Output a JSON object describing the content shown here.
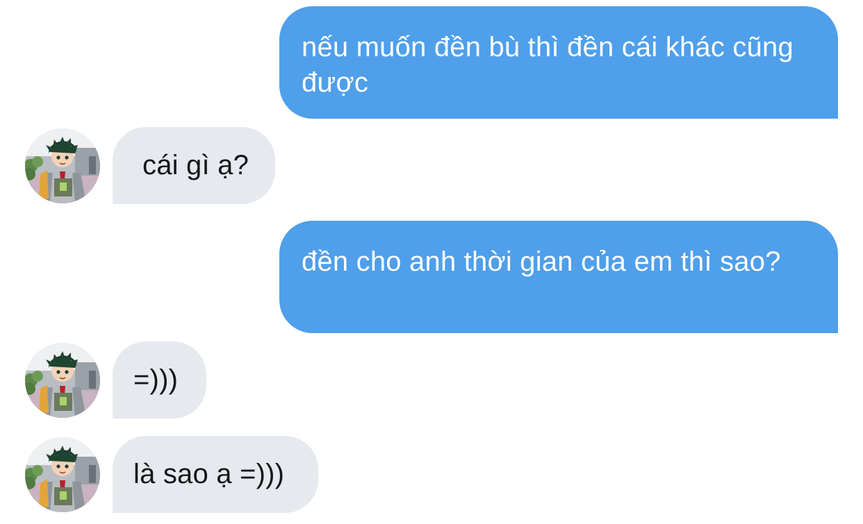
{
  "messages": [
    {
      "direction": "outgoing",
      "text": "nếu muốn đền bù thì đền cái khác cũng được"
    },
    {
      "direction": "incoming",
      "text": "cái gì ạ?"
    },
    {
      "direction": "outgoing",
      "text": "đền cho anh thời gian của em thì sao?"
    },
    {
      "direction": "incoming",
      "text": "=)))"
    },
    {
      "direction": "incoming",
      "text": "là sao ạ =)))"
    }
  ],
  "colors": {
    "outgoing_bubble": "#4f9fea",
    "incoming_bubble": "#e6e9ee",
    "outgoing_text": "#ffffff",
    "incoming_text": "#14171a"
  },
  "avatar": {
    "icon": "anime-character-avatar"
  }
}
